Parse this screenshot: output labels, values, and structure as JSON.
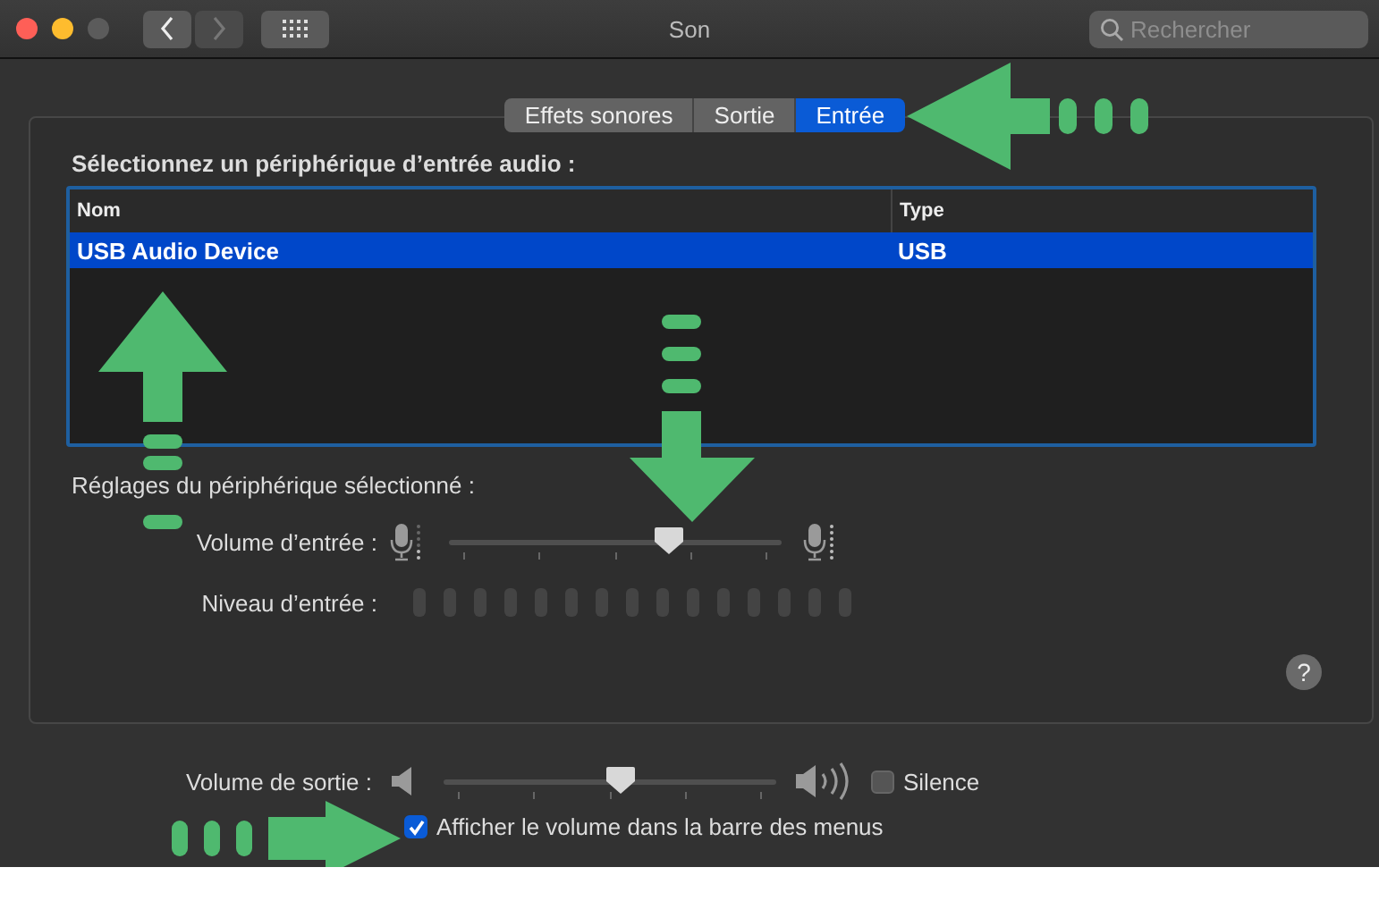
{
  "window": {
    "title": "Son",
    "navigation": [
      {
        "kind": "back",
        "disabled": false
      },
      {
        "kind": "forward",
        "disabled": true
      }
    ],
    "search": {
      "placeholder": "Rechercher"
    }
  },
  "tabs": [
    {
      "label": "Effets sonores",
      "selected": false
    },
    {
      "label": "Sortie",
      "selected": false
    },
    {
      "label": "Entrée",
      "selected": true
    }
  ],
  "device_list": {
    "label": "Sélectionnez un périphérique d’entrée audio :",
    "columns": [
      "Nom",
      "Type"
    ],
    "rows": [
      {
        "cells": [
          "USB Audio Device",
          "USB"
        ],
        "selected": true
      }
    ]
  },
  "settings": {
    "label": "Réglages du périphérique sélectionné :",
    "input_volume": {
      "label": "Volume d’entrée :",
      "level": 0.66
    },
    "input_level": {
      "label": "Niveau d’entrée :"
    }
  },
  "help": {
    "label": "?"
  },
  "output": {
    "label": "Volume de sortie :",
    "level": 0.53,
    "mute": {
      "label": "Silence",
      "checked": false
    }
  },
  "menu_bar_option": {
    "label": "Afficher le volume dans la barre des menus",
    "checked": true
  }
}
